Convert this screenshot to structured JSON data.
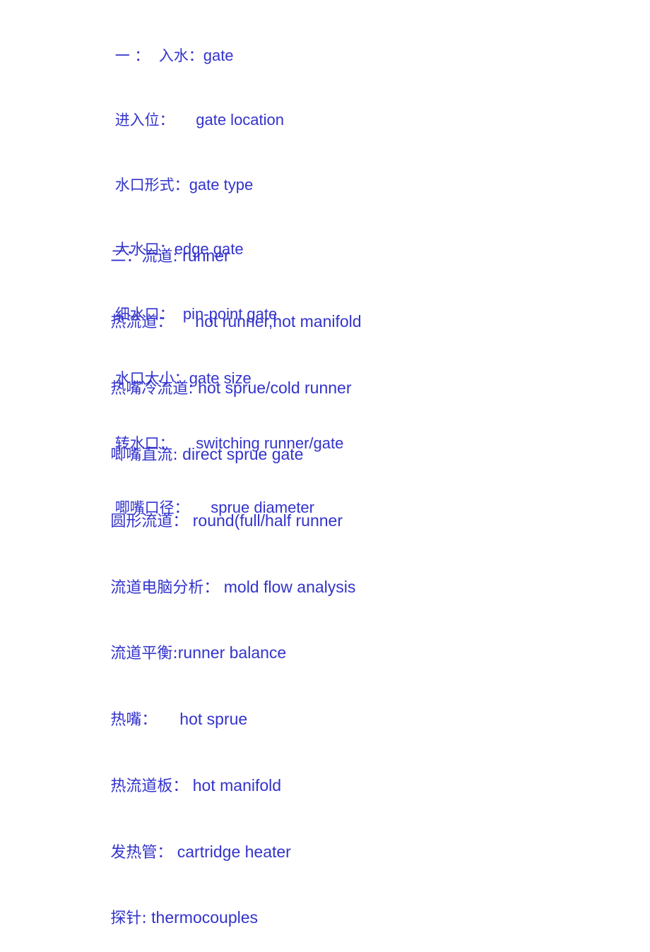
{
  "document": {
    "text_color": "#3333cc",
    "background_color": "#ffffff",
    "sections": [
      {
        "id": "section-one",
        "lines": [
          {
            "cn": "一 ：  入水：",
            "en": "gate"
          },
          {
            "cn": "进入位：",
            "en": "     gate location"
          },
          {
            "cn": "水口形式：",
            "en": "gate type"
          },
          {
            "cn": "大水口：",
            "en": "edge gate"
          },
          {
            "cn": "细水口：",
            "en": "  pin-point gate"
          },
          {
            "cn": "水口大小：",
            "en": "gate size"
          },
          {
            "cn": "转水口：",
            "en": "     switching runner/gate"
          },
          {
            "cn": "唧嘴口径：",
            "en": "     sprue diameter"
          }
        ]
      },
      {
        "id": "section-two",
        "lines": [
          {
            "cn": "二：流道:",
            "en": " runner"
          },
          {
            "cn": "热流道：",
            "en": "     hot runner,hot manifold"
          },
          {
            "cn": "热嘴冷流道:",
            "en": " hot sprue/cold runner"
          },
          {
            "cn": "唧嘴直流:",
            "en": " direct sprue gate"
          },
          {
            "cn": "圆形流道：",
            "en": " round(full/half runner"
          },
          {
            "cn": "流道电脑分析：",
            "en": " mold flow analysis"
          },
          {
            "cn": "流道平衡:",
            "en": "runner balance"
          },
          {
            "cn": "热嘴：",
            "en": "     hot sprue"
          },
          {
            "cn": "热流道板：",
            "en": " hot manifold"
          },
          {
            "cn": "发热管：",
            "en": " cartridge heater"
          },
          {
            "cn": "探针:",
            "en": " thermocouples"
          }
        ]
      }
    ]
  }
}
